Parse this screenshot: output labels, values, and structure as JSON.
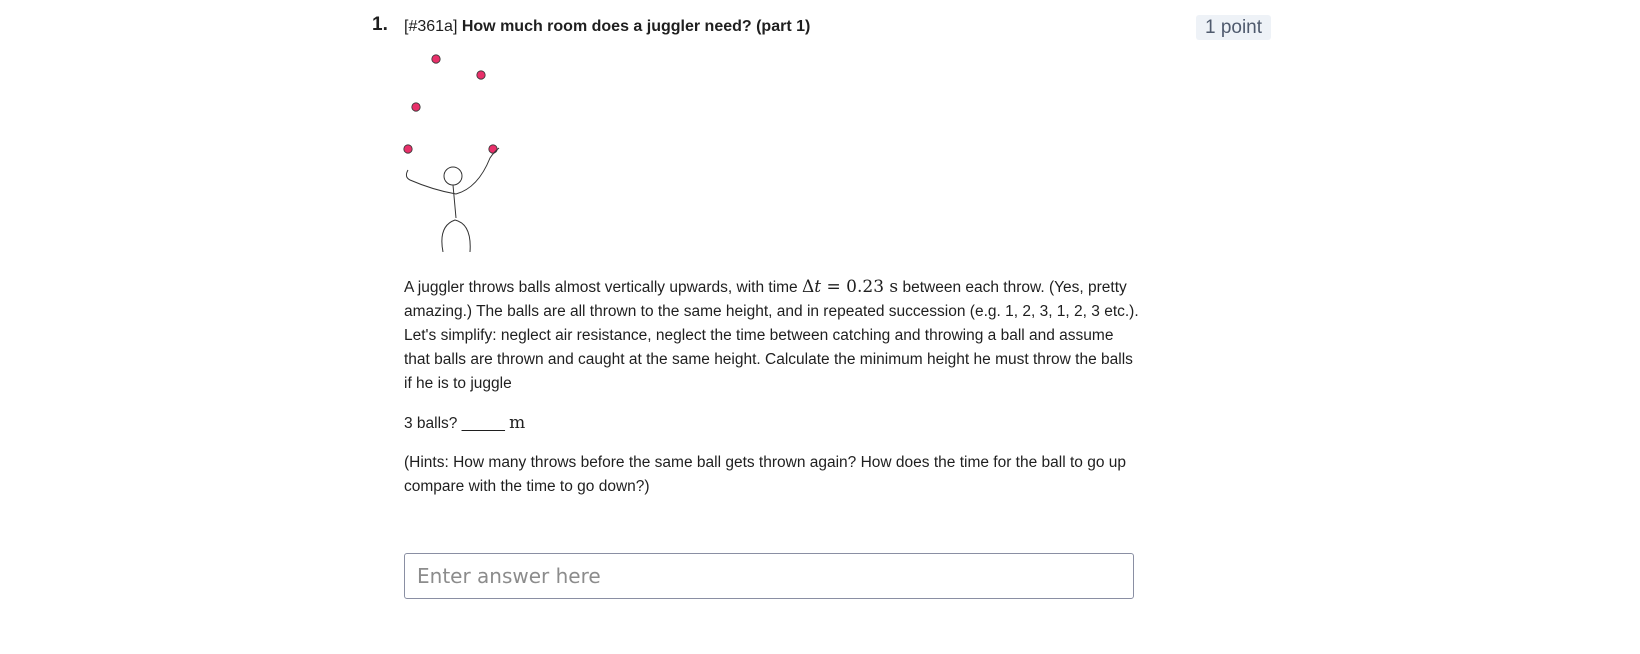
{
  "question": {
    "number": "1.",
    "tag": "[#361a]",
    "title": "How much room does a juggler need? (part 1)",
    "points": "1 point"
  },
  "body": {
    "p1_before": "A juggler throws balls almost vertically upwards, with time ",
    "math_delta": "Δ",
    "math_t": "t",
    "math_eq": " = 0.23 ",
    "math_unit": "s",
    "p1_after": " between each throw. (Yes, pretty amazing.) The balls are all thrown to the same height, and in repeated succession (e.g. 1, 2, 3, 1, 2, 3 etc.). Let's simplify: neglect air resistance, neglect the time between catching and throwing a ball and assume that balls are thrown and caught at the same height. Calculate the minimum height he must throw the balls if he is to juggle",
    "p2_text": "3 balls? _____ ",
    "p2_unit": "m",
    "p3_text": "(Hints: How many throws before the same ball gets thrown again? How does the time for the ball to go up compare with the time to go down?)"
  },
  "answer": {
    "placeholder": "Enter answer here"
  },
  "colors": {
    "ball": "#e8306a",
    "points_bg": "#eef2f7",
    "points_text": "#4f5a6d",
    "input_border": "#8a8fa3"
  },
  "icons": {
    "figure": "juggler-illustration"
  }
}
